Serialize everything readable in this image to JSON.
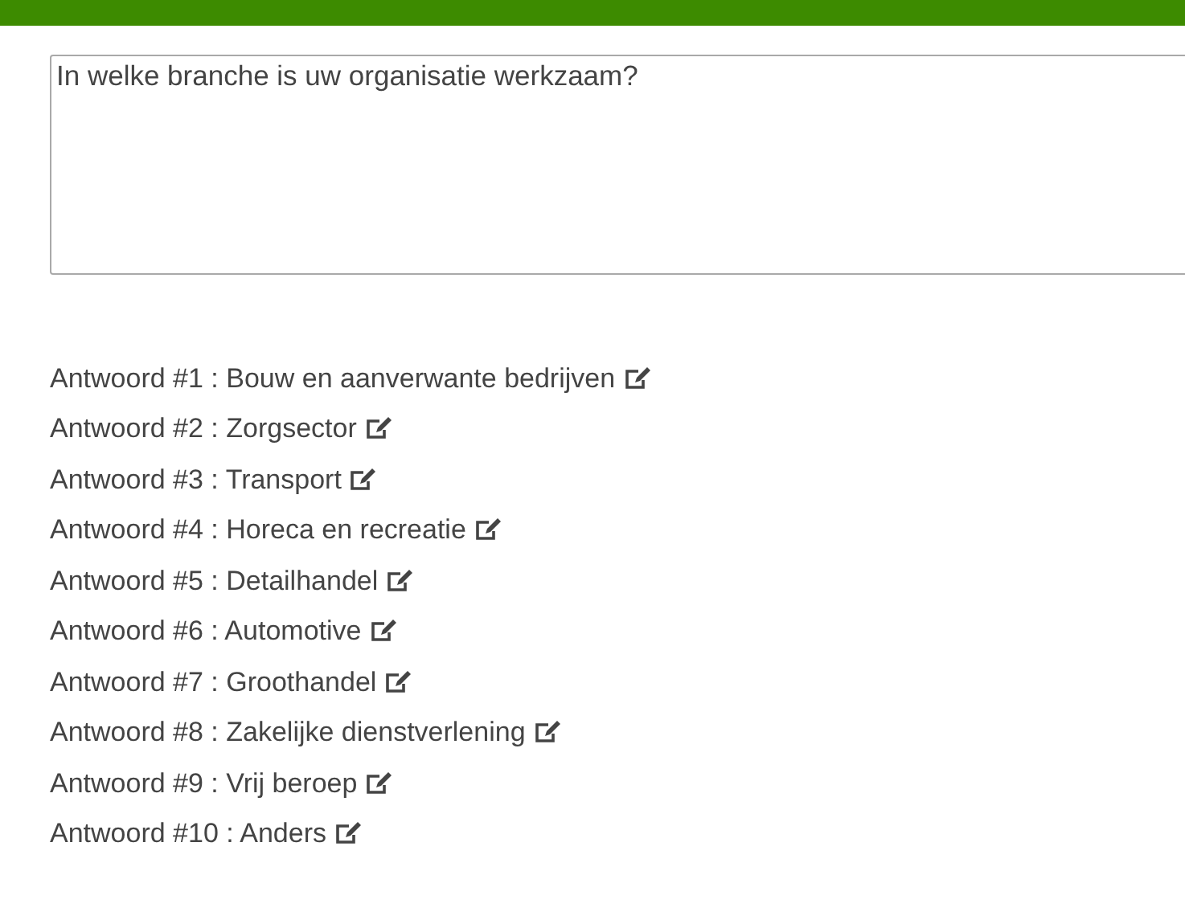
{
  "header_bar": {
    "kind": "bar"
  },
  "question": {
    "value": "In welke branche is uw organisatie werkzaam?"
  },
  "answers": [
    {
      "text": "Antwoord #1 : Bouw en aanverwante bedrijven"
    },
    {
      "text": "Antwoord #2 : Zorgsector"
    },
    {
      "text": "Antwoord #3 : Transport"
    },
    {
      "text": "Antwoord #4 : Horeca en recreatie"
    },
    {
      "text": "Antwoord #5 : Detailhandel"
    },
    {
      "text": "Antwoord #6 : Automotive"
    },
    {
      "text": "Antwoord #7 : Groothandel"
    },
    {
      "text": "Antwoord #8 : Zakelijke dienstverlening"
    },
    {
      "text": "Antwoord #9 : Vrij beroep"
    },
    {
      "text": "Antwoord #10 : Anders"
    }
  ]
}
